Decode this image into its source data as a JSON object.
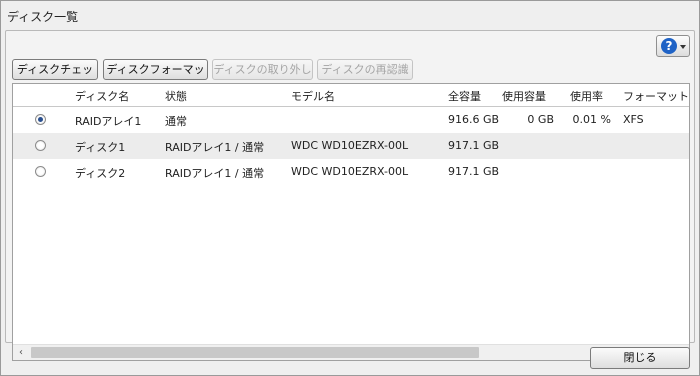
{
  "window": {
    "title": "ディスク一覧"
  },
  "toolbar": {
    "buttons": [
      {
        "label": "ディスクチェック",
        "enabled": true
      },
      {
        "label": "ディスクフォーマット",
        "enabled": true
      },
      {
        "label": "ディスクの取り外し",
        "enabled": false
      },
      {
        "label": "ディスクの再認識",
        "enabled": false
      }
    ],
    "help_icon": "question-icon"
  },
  "table": {
    "columns": [
      "ディスク名",
      "状態",
      "モデル名",
      "全容量",
      "使用容量",
      "使用率",
      "フォーマット"
    ],
    "rows": [
      {
        "selected": true,
        "name": "RAIDアレイ1",
        "status": "通常",
        "model": "",
        "total": "916.6 GB",
        "used": "0 GB",
        "usage": "0.01 %",
        "format": "XFS"
      },
      {
        "selected": false,
        "name": "ディスク1",
        "status": "RAIDアレイ1 / 通常",
        "model": "WDC WD10EZRX-00L",
        "total": "917.1 GB",
        "used": "",
        "usage": "",
        "format": ""
      },
      {
        "selected": false,
        "name": "ディスク2",
        "status": "RAIDアレイ1 / 通常",
        "model": "WDC WD10EZRX-00L",
        "total": "917.1 GB",
        "used": "",
        "usage": "",
        "format": ""
      }
    ]
  },
  "footer": {
    "close_label": "閉じる"
  },
  "colors": {
    "help_icon_bg": "#1f63c6",
    "alt_row": "#ececec"
  }
}
